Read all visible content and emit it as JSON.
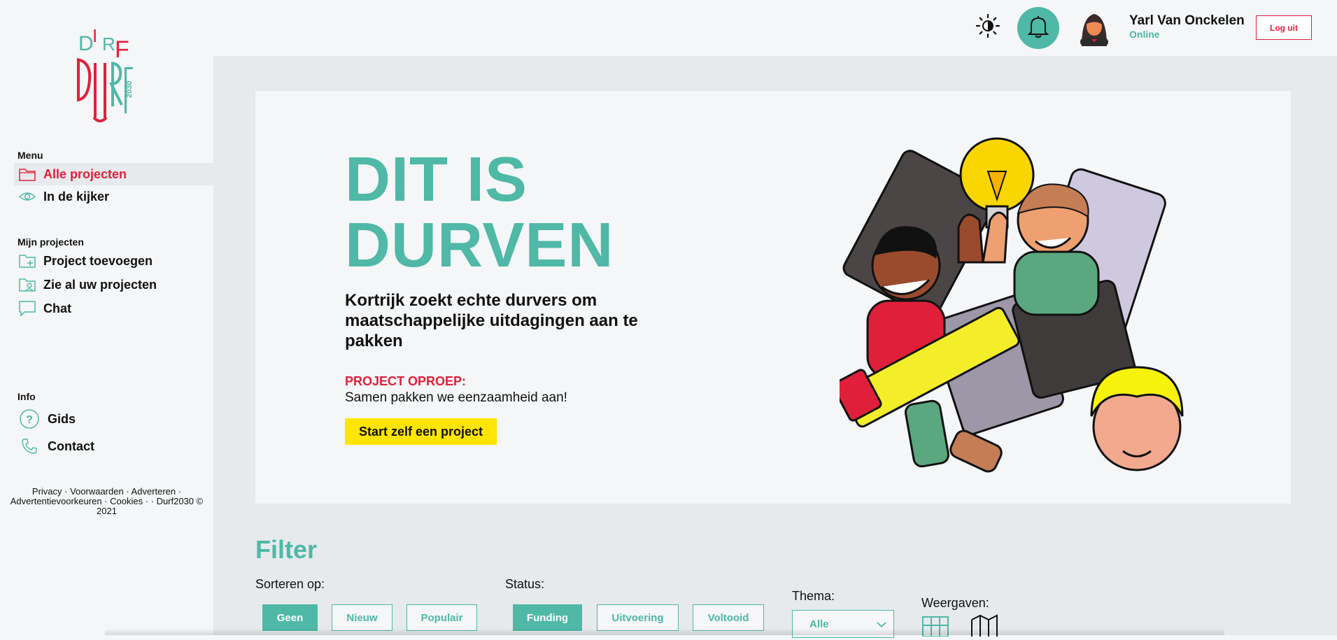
{
  "sidebar": {
    "logo_text": "DURF 2030",
    "menu_heading": "Menu",
    "menu_items": [
      {
        "label": "Alle projecten",
        "icon": "folder-icon",
        "active": true
      },
      {
        "label": "In de kijker",
        "icon": "eye-icon",
        "active": false
      }
    ],
    "my_projects_heading": "Mijn projecten",
    "my_projects_items": [
      {
        "label": "Project toevoegen",
        "icon": "folder-add-icon"
      },
      {
        "label": "Zie al uw projecten",
        "icon": "folder-user-icon"
      },
      {
        "label": "Chat",
        "icon": "chat-icon"
      }
    ],
    "info_heading": "Info",
    "info_items": [
      {
        "label": "Gids",
        "icon": "help-circle-icon"
      },
      {
        "label": "Contact",
        "icon": "phone-icon"
      }
    ],
    "footer_line1": "Privacy · Voorwaarden · Adverteren ·",
    "footer_line2": "Advertentievoorkeuren · Cookies · · Durf2030 ©",
    "footer_line3": "2021"
  },
  "topbar": {
    "theme_icon": "sun-icon",
    "bell_icon": "bell-icon",
    "user_name": "Yarl Van Onckelen",
    "user_status": "Online",
    "logout_label": "Log uit"
  },
  "hero": {
    "title_line1": "DIT IS",
    "title_line2": "DURVEN",
    "subtitle": "Kortrijk zoekt echte durvers om maatschappelijke uitdagingen aan te pakken",
    "call_label": "PROJECT OPROEP:",
    "call_text": "Samen pakken we eenzaamheid aan!",
    "cta_label": "Start zelf een project"
  },
  "filter": {
    "title": "Filter",
    "sort_label": "Sorteren op:",
    "sort_options": [
      "Geen",
      "Nieuw",
      "Populair"
    ],
    "sort_selected": "Geen",
    "status_label": "Status:",
    "status_options": [
      "Funding",
      "Uitvoering",
      "Voltooid"
    ],
    "status_selected": "Funding",
    "theme_label": "Thema:",
    "theme_value": "Alle",
    "view_label": "Weergaven:"
  },
  "colors": {
    "teal": "#4fb8a6",
    "red": "#e0203a",
    "yellow": "#ffe500"
  }
}
